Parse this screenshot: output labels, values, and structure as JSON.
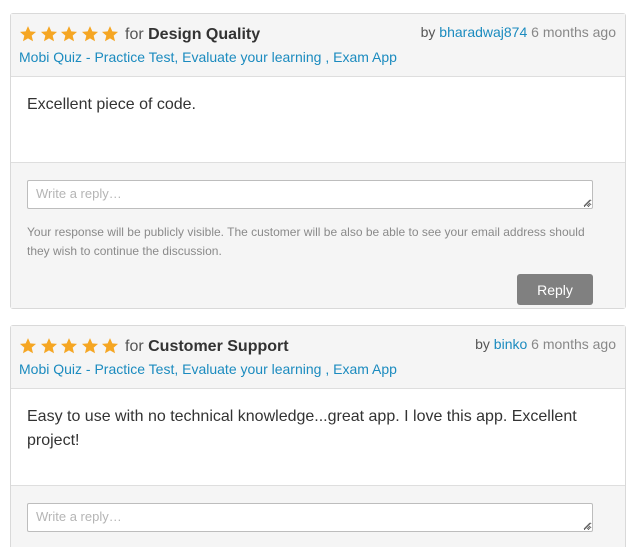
{
  "reviews": [
    {
      "rating": 5,
      "for_word": "for",
      "category": "Design Quality",
      "by_word": "by",
      "username": "bharadwaj874",
      "time_ago": "6 months ago",
      "item": "Mobi Quiz - Practice Test, Evaluate your learning , Exam App",
      "body": "Excellent piece of code.",
      "reply_placeholder": "Write a reply…",
      "notice": "Your response will be publicly visible. The customer will be also be able to see your email address should they wish to continue the discussion.",
      "reply_label": "Reply"
    },
    {
      "rating": 5,
      "for_word": "for",
      "category": "Customer Support",
      "by_word": "by",
      "username": "binko",
      "time_ago": "6 months ago",
      "item": "Mobi Quiz - Practice Test, Evaluate your learning , Exam App",
      "body": "Easy to use with no technical knowledge...great app. I love this app. Excellent project!",
      "reply_placeholder": "Write a reply…"
    }
  ],
  "colors": {
    "star": "#f5a623",
    "link": "#1b8bbf",
    "button": "#808080"
  }
}
